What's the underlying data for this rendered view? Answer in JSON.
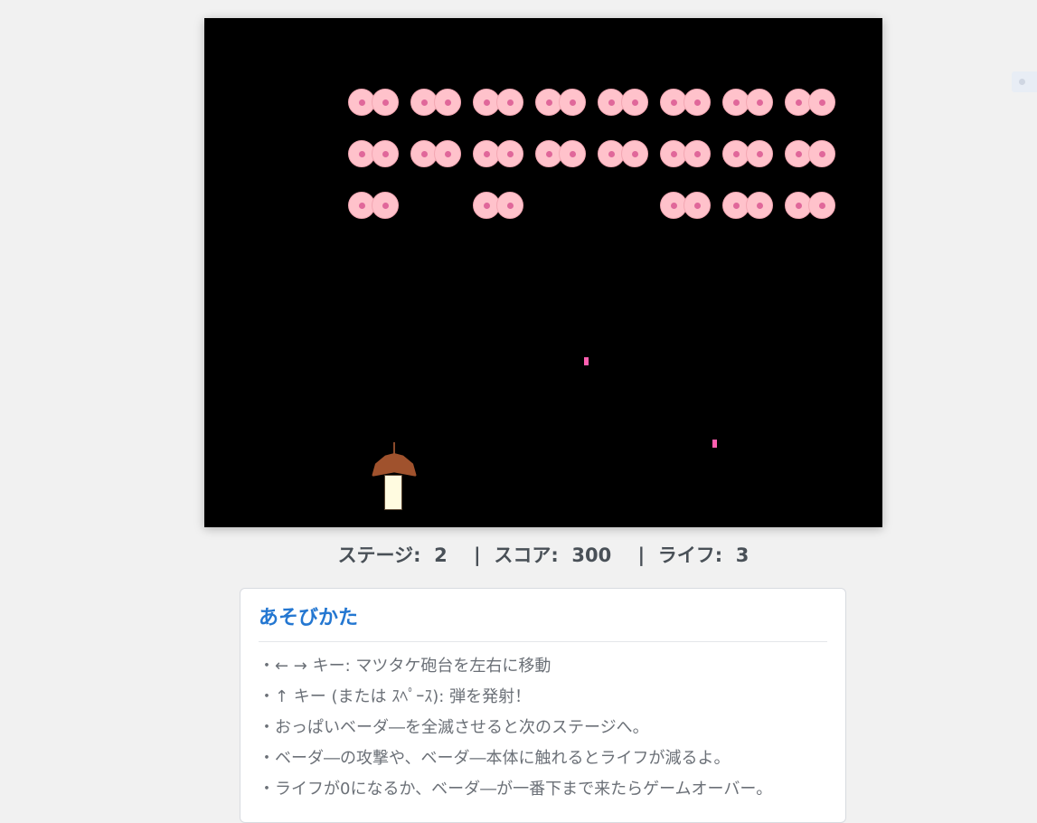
{
  "hud": {
    "stage_label": "ステージ:",
    "stage_value": "2",
    "separator": "|",
    "score_label": "スコア:",
    "score_value": "300",
    "lives_label": "ライフ:",
    "lives_value": "3"
  },
  "game": {
    "background_color": "#000000",
    "invader_color": "#ffc2cb",
    "nipple_color": "#e0679a",
    "bullet_color": "#ff5fb0",
    "invader_icon": "boob-invader-icon",
    "player_icon": "matsutake-cannon-icon",
    "invader_rows": [
      [
        1,
        1,
        1,
        1,
        1,
        1,
        1,
        1
      ],
      [
        1,
        1,
        1,
        1,
        1,
        1,
        1,
        1
      ],
      [
        1,
        0,
        1,
        0,
        0,
        1,
        1,
        1
      ]
    ]
  },
  "help": {
    "title": "あそびかた",
    "items": [
      "← → キー: マツタケ砲台を左右に移動",
      "↑ キー (または ｽﾍﾟｰｽ): 弾を発射！",
      "おっぱいベーダ―を全滅させると次のステージへ。",
      "ベーダ―の攻撃や、ベーダ―本体に触れるとライフが減るよ。",
      "ライフが0になるか、ベーダ―が一番下まで来たらゲームオーバー。"
    ]
  }
}
